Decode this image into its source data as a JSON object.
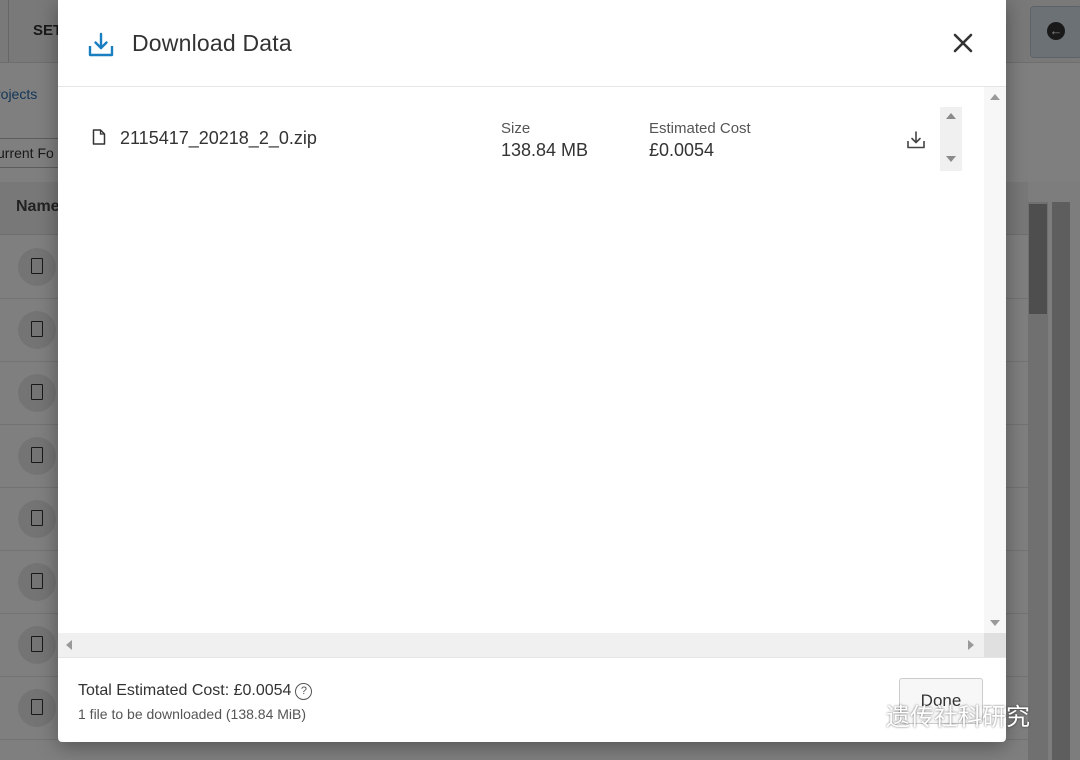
{
  "background": {
    "top_tab_label": "SET",
    "breadcrumb": "rojects",
    "folder_select": "urrent Fo",
    "table_header_name": "Name"
  },
  "modal": {
    "title": "Download Data",
    "file": {
      "name": "2115417_20218_2_0.zip",
      "size_label": "Size",
      "size_value": "138.84 MB",
      "cost_label": "Estimated Cost",
      "cost_value": "£0.0054"
    },
    "footer": {
      "total_cost": "Total Estimated Cost: £0.0054",
      "help_glyph": "?",
      "summary": "1 file to be downloaded (138.84 MiB)",
      "done_label": "Done"
    }
  },
  "watermark": {
    "text": "遗传社科研究"
  },
  "colors": {
    "accent": "#1a7fc1",
    "overlay": "#7d7d7d",
    "text": "#333333"
  },
  "icons": [
    "download-icon",
    "close-icon",
    "file-icon",
    "help-icon",
    "back-arrow-icon"
  ]
}
